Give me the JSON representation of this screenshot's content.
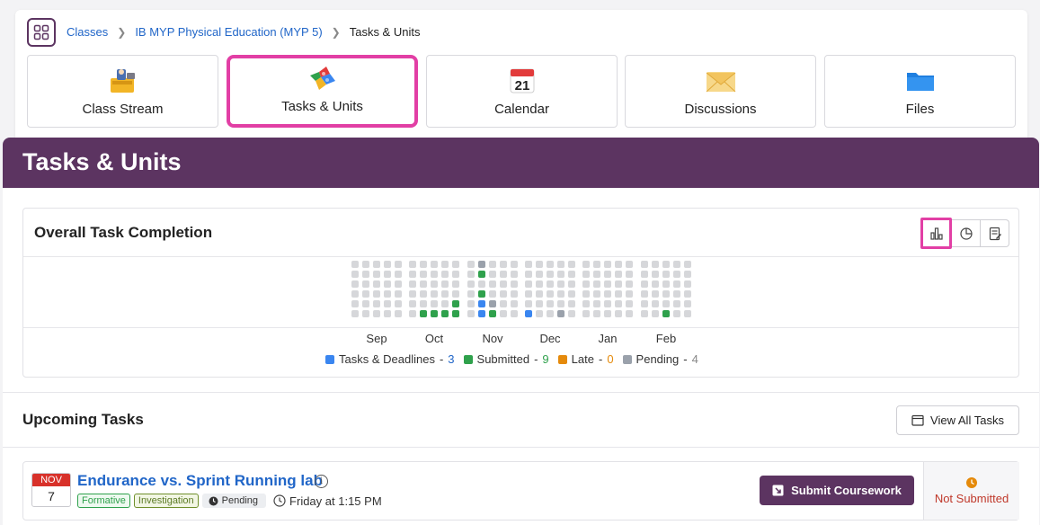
{
  "breadcrumb": {
    "items": [
      "Classes",
      "IB MYP Physical Education (MYP 5)",
      "Tasks & Units"
    ]
  },
  "nav_tiles": [
    {
      "label": "Class Stream",
      "icon": "class-stream-icon"
    },
    {
      "label": "Tasks & Units",
      "icon": "puzzle-icon",
      "active": true
    },
    {
      "label": "Calendar",
      "icon": "calendar-icon",
      "day": "21"
    },
    {
      "label": "Discussions",
      "icon": "envelope-icon"
    },
    {
      "label": "Files",
      "icon": "folder-icon"
    }
  ],
  "page_title": "Tasks & Units",
  "completion": {
    "title": "Overall Task Completion",
    "view_modes": [
      "bar-chart-icon",
      "pie-chart-icon",
      "report-icon"
    ],
    "active_view": "bar-chart-icon",
    "months": [
      "Sep",
      "Oct",
      "Nov",
      "Dec",
      "Jan",
      "Feb"
    ],
    "legend": [
      {
        "label": "Tasks & Deadlines",
        "count": "3",
        "color": "#3a86f0"
      },
      {
        "label": "Submitted",
        "count": "9",
        "color": "#2fa14c"
      },
      {
        "label": "Late",
        "count": "0",
        "color": "#e58a0b"
      },
      {
        "label": "Pending",
        "count": "4",
        "color": "#9aa1ab"
      }
    ]
  },
  "upcoming": {
    "title": "Upcoming Tasks",
    "view_all_label": "View All Tasks"
  },
  "task": {
    "month": "NOV",
    "day": "7",
    "title": "Endurance vs. Sprint Running lab",
    "tags": [
      "Formative",
      "Investigation"
    ],
    "status_tag": "Pending",
    "due": "Friday at 1:15 PM",
    "submit_label": "Submit Coursework",
    "submission_status": "Not Submitted"
  },
  "colors": {
    "brand": "#5c3461",
    "highlight": "#e23fa5",
    "link": "#2166c8"
  }
}
